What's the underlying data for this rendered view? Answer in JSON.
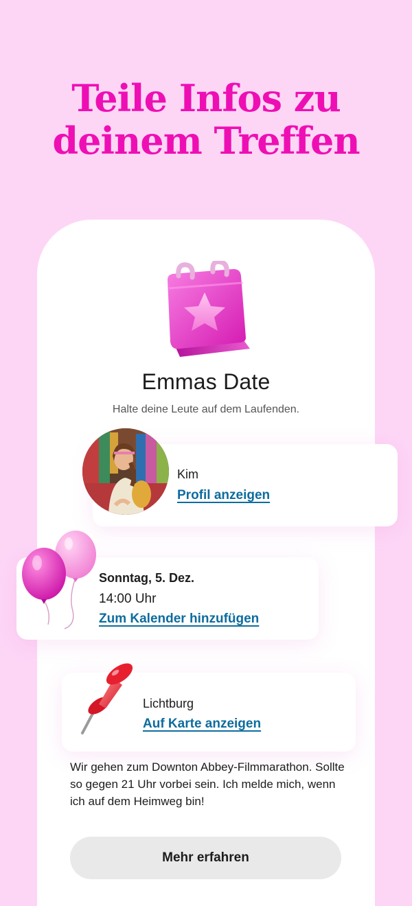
{
  "headline": {
    "line1": "Teile Infos zu",
    "line2": "deinem Treffen"
  },
  "event": {
    "title": "Emmas Date",
    "subtitle": "Halte deine Leute auf dem Laufenden."
  },
  "contact": {
    "name": "Kim",
    "link": "Profil anzeigen"
  },
  "schedule": {
    "date": "Sonntag, 5. Dez.",
    "time": "14:00 Uhr",
    "link": "Zum Kalender hinzufügen"
  },
  "location": {
    "name": "Lichtburg",
    "link": "Auf Karte anzeigen"
  },
  "message": "Wir gehen zum Downton Abbey-Filmmarathon. Sollte so gegen 21 Uhr vorbei sein. Ich melde mich, wenn ich auf dem Heimweg bin!",
  "cta": {
    "label": "Mehr erfahren"
  },
  "colors": {
    "background": "#fdd6f6",
    "headline": "#ee0fb4",
    "link": "#0d6c9e",
    "button": "#e9e9e9"
  },
  "icons": {
    "calendar": "calendar-star-icon",
    "balloons": "balloons-icon",
    "pin": "pushpin-icon"
  }
}
